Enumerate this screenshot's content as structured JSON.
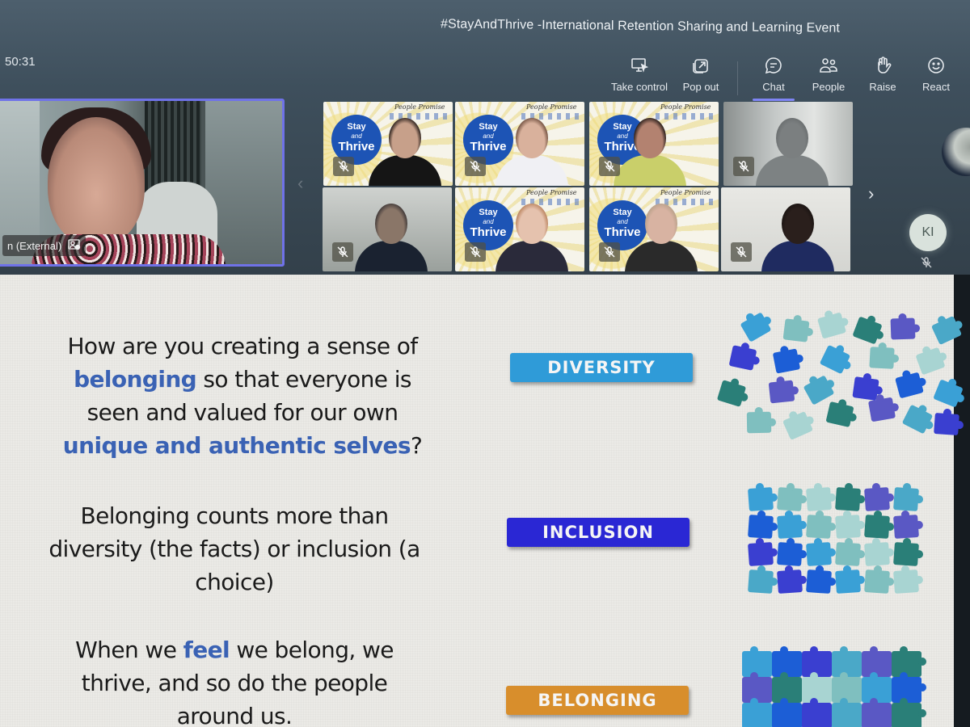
{
  "meeting": {
    "title": "#StayAndThrive -International Retention Sharing and Learning Event",
    "elapsed_time": "50:31"
  },
  "toolbar": {
    "take_control": {
      "label": "Take control",
      "icon": "screen-pointer-icon"
    },
    "pop_out": {
      "label": "Pop out",
      "icon": "pop-out-icon"
    },
    "chat": {
      "label": "Chat",
      "icon": "chat-bubble-icon",
      "active": true
    },
    "people": {
      "label": "People",
      "icon": "people-icon"
    },
    "raise": {
      "label": "Raise",
      "icon": "hand-icon"
    },
    "react": {
      "label": "React",
      "icon": "smiley-icon"
    }
  },
  "speaker": {
    "name_suffix": "n (External)",
    "pinned_indicator_icon": "spotlight-icon"
  },
  "gallery": {
    "prev_icon": "chevron-left-icon",
    "next_icon": "chevron-right-icon",
    "tiles": [
      {
        "background": "branded",
        "badge": {
          "line1": "Stay",
          "line2": "and",
          "line3": "Thrive"
        },
        "header": "People Promise",
        "muted": true
      },
      {
        "background": "branded",
        "badge": {
          "line1": "Stay",
          "line2": "and",
          "line3": "Thrive"
        },
        "header": "People Promise",
        "muted": true
      },
      {
        "background": "branded",
        "badge": {
          "line1": "Stay",
          "line2": "and",
          "line3": "Thrive"
        },
        "header": "People Promise",
        "muted": true
      },
      {
        "background": "office",
        "muted": true
      },
      {
        "background": "room",
        "muted": true
      },
      {
        "background": "branded",
        "badge": {
          "line1": "Stay",
          "line2": "and",
          "line3": "Thrive"
        },
        "header": "People Promise",
        "muted": true
      },
      {
        "background": "branded",
        "badge": {
          "line1": "Stay",
          "line2": "and",
          "line3": "Thrive"
        },
        "header": "People Promise",
        "muted": true
      },
      {
        "background": "wall",
        "muted": true
      }
    ],
    "side_participants": [
      {
        "type": "photo"
      },
      {
        "type": "initials",
        "initials": "KI",
        "muted": true
      }
    ]
  },
  "slide": {
    "question": {
      "part1": "How are you creating a sense of ",
      "highlight1": "belonging",
      "part2": " so that everyone is seen and valued for our own ",
      "highlight2": "unique and authentic selves",
      "part3": "?"
    },
    "statement": "Belonging counts more than diversity (the facts) or inclusion (a choice)",
    "closing": {
      "part1": "When we ",
      "highlight": "feel",
      "part2": " we belong, we thrive, and so do the people around us."
    },
    "labels": {
      "diversity": "DIVERSITY",
      "inclusion": "INCLUSION",
      "belonging": "BELONGING"
    },
    "colors": {
      "diversity": "#2f9bd8",
      "inclusion": "#2a27d4",
      "belonging": "#d88e2c",
      "highlight_text": "#3a62b4"
    },
    "images": {
      "diversity": "scattered-puzzle-pieces",
      "inclusion": "loosely-arranged-puzzle-pieces",
      "belonging": "completed-puzzle"
    }
  },
  "theme": {
    "accent": "#7f85f5",
    "active_speaker_border": "#6f72e8",
    "puzzle_palette": [
      "#3aa0d6",
      "#2a7f78",
      "#3a3fd0",
      "#7fbfbf",
      "#5a58c4",
      "#1c5ed6",
      "#a8d4d2",
      "#4aa8c8"
    ]
  }
}
